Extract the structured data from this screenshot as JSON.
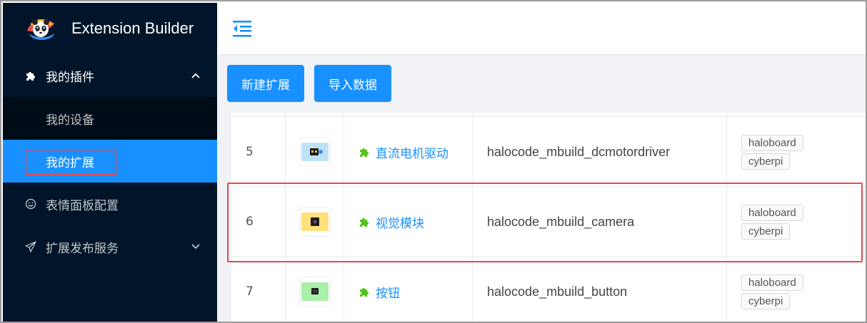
{
  "app": {
    "title": "Extension Builder"
  },
  "sidebar": {
    "menu_plugins": {
      "label": "我的插件",
      "icon": "puzzle-icon",
      "chevron": "chevron-up-icon"
    },
    "sub_items": [
      {
        "label": "我的设备",
        "active": false
      },
      {
        "label": "我的扩展",
        "active": true
      }
    ],
    "menu_emoji": {
      "label": "表情面板配置",
      "icon": "smile-icon"
    },
    "menu_publish": {
      "label": "扩展发布服务",
      "icon": "send-icon",
      "chevron": "chevron-down-icon"
    }
  },
  "topbar": {
    "toggle_icon": "menu-fold-icon"
  },
  "toolbar": {
    "new_label": "新建扩展",
    "import_label": "导入数据"
  },
  "table": {
    "rows": [
      {
        "index": "5",
        "name": "直流电机驱动",
        "id": "halocode_mbuild_dcmotordriver",
        "tags": [
          "haloboard",
          "cyberpi"
        ],
        "thumb_color": "#bfe3f5"
      },
      {
        "index": "6",
        "name": "视觉模块",
        "id": "halocode_mbuild_camera",
        "tags": [
          "haloboard",
          "cyberpi"
        ],
        "thumb_color": "#ffe07a"
      },
      {
        "index": "7",
        "name": "按钮",
        "id": "halocode_mbuild_button",
        "tags": [
          "haloboard",
          "cyberpi"
        ],
        "thumb_color": "#a9f0a9"
      }
    ]
  },
  "colors": {
    "sidebar_bg": "#001529",
    "accent": "#1890ff",
    "highlight": "#e04a55",
    "puzzle_green": "#52c41a"
  }
}
